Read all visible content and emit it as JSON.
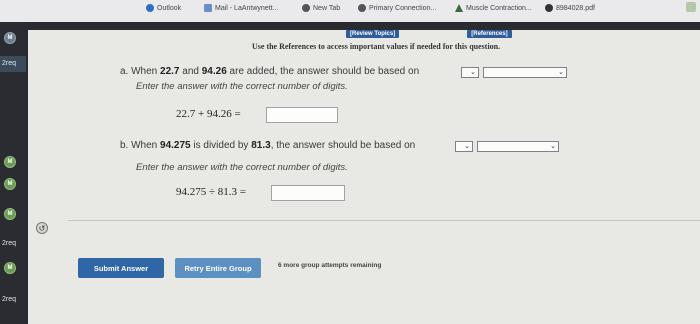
{
  "bookmarks": [
    {
      "label": "Outlook",
      "icon": "outlook-icon"
    },
    {
      "label": "Mail - LaAntwynett...",
      "icon": "mail-icon"
    },
    {
      "label": "New Tab",
      "icon": "globe-icon"
    },
    {
      "label": "Primary Connection...",
      "icon": "globe-icon"
    },
    {
      "label": "Muscle Contraction...",
      "icon": "drive-icon"
    },
    {
      "label": "8984028.pdf",
      "icon": "globe-icon"
    }
  ],
  "sidebar": {
    "req_labels": [
      "2req",
      "2req",
      "2req"
    ],
    "badge": "M"
  },
  "header": {
    "review_topics": "[Review Topics]",
    "references": "[References]",
    "note": "Use the References to access important values if needed for this question."
  },
  "part_a": {
    "prefix": "a. When ",
    "n1": "22.7",
    "mid": " and ",
    "n2": "94.26",
    "suffix": " are added, the answer should be based on",
    "instruction": "Enter the answer with the correct number of digits.",
    "equation": "22.7 + 94.26 ="
  },
  "part_b": {
    "prefix": "b. When ",
    "n1": "94.275",
    "mid": " is divided by ",
    "n2": "81.3",
    "suffix": ", the answer should be based on",
    "instruction": "Enter the answer with the correct number of digits.",
    "equation": "94.275 ÷ 81.3 ="
  },
  "buttons": {
    "submit": "Submit Answer",
    "retry": "Retry Entire Group",
    "remaining": "6 more group attempts remaining"
  },
  "colors": {
    "submit": "#2f66a6",
    "retry": "#5c8fc2",
    "reference": "#2f5d9a"
  }
}
